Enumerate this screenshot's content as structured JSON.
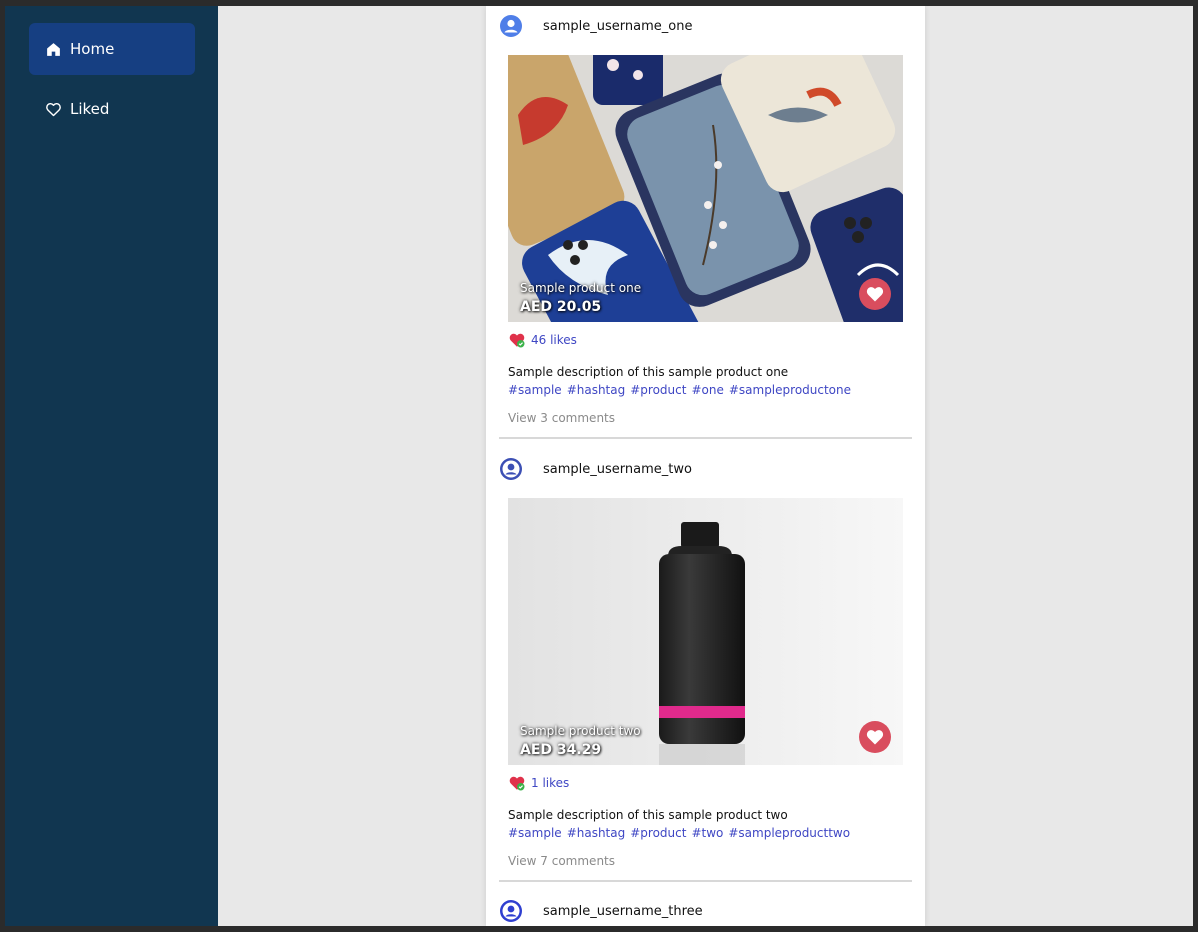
{
  "sidebar": {
    "items": [
      {
        "label": "Home",
        "icon": "home-icon",
        "active": true
      },
      {
        "label": "Liked",
        "icon": "heart-outline-icon",
        "active": false
      }
    ]
  },
  "colors": {
    "sidebar_bg": "#113650",
    "active_item": "#163f82",
    "link": "#3f47c4",
    "like_button": "#d94d5e"
  },
  "posts": [
    {
      "username": "sample_username_one",
      "avatar_icon": "user-avatar-icon",
      "product_name": "Sample product one",
      "price": "AED 20.05",
      "likes": "46 likes",
      "description": "Sample description of this sample product one",
      "hashtags": [
        "#sample",
        "#hashtag",
        "#product",
        "#one",
        "#sampleproductone"
      ],
      "comments_link": "View 3 comments"
    },
    {
      "username": "sample_username_two",
      "avatar_icon": "user-avatar-icon",
      "product_name": "Sample product two",
      "price": "AED 34.29",
      "likes": "1 likes",
      "description": "Sample description of this sample product two",
      "hashtags": [
        "#sample",
        "#hashtag",
        "#product",
        "#two",
        "#sampleproducttwo"
      ],
      "comments_link": "View 7 comments"
    },
    {
      "username": "sample_username_three",
      "avatar_icon": "user-avatar-icon"
    }
  ]
}
